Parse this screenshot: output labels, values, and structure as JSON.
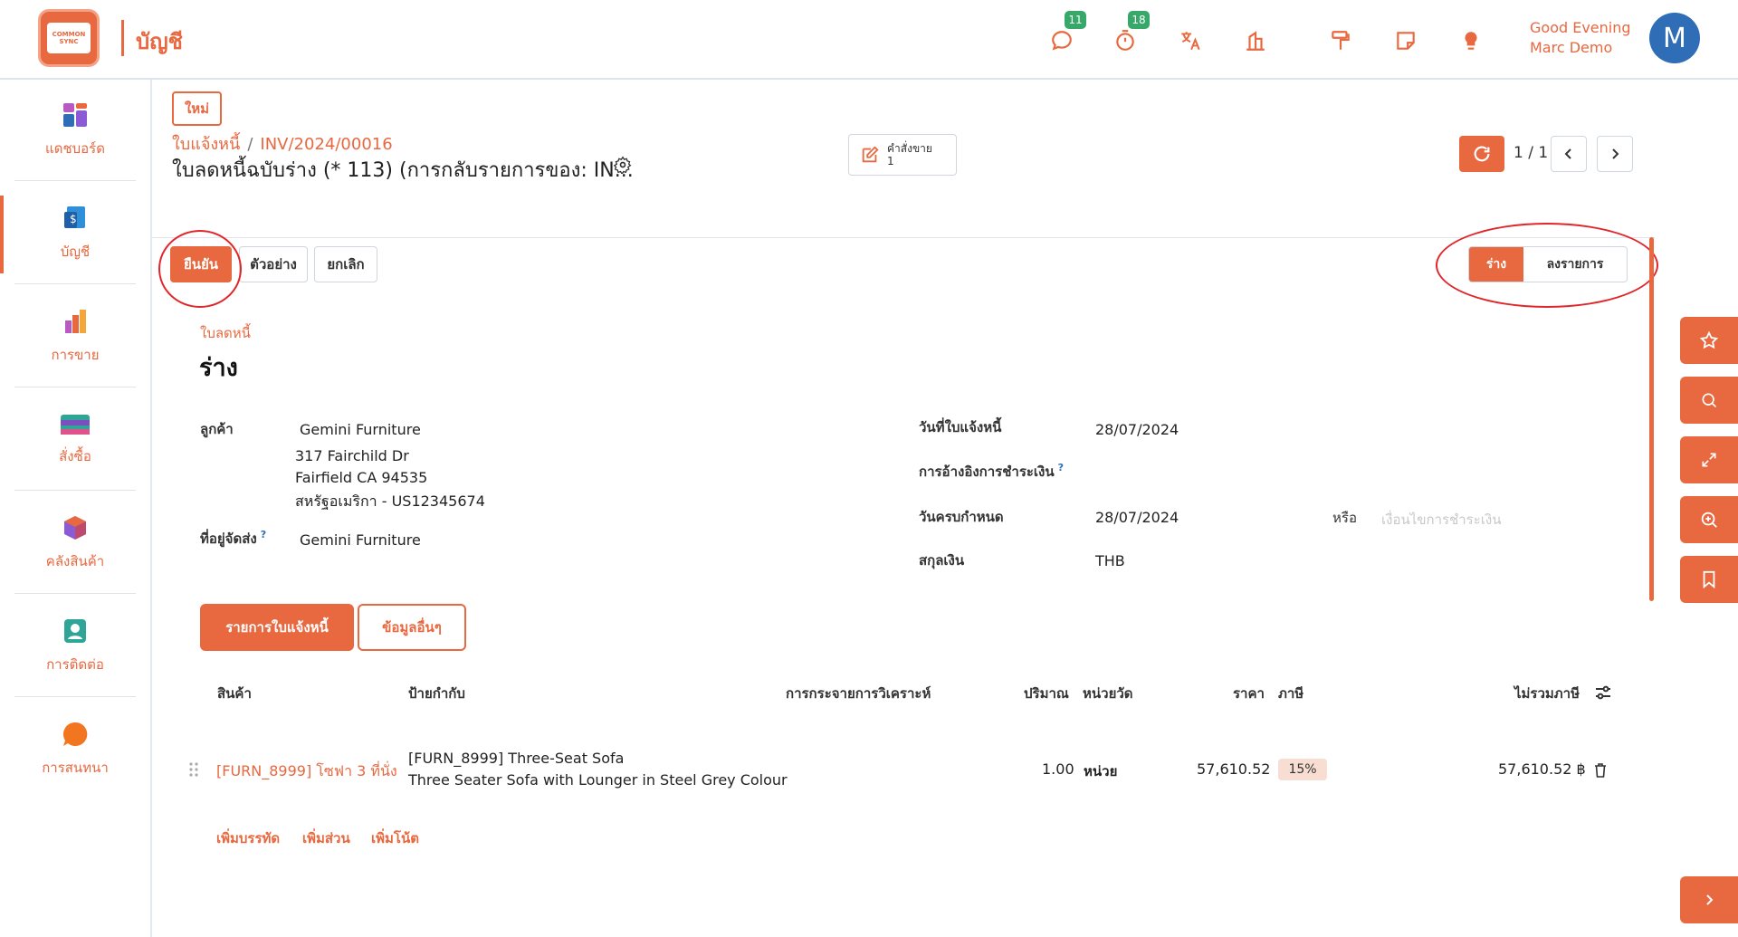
{
  "app": {
    "logo_text": "COMMON SYNC",
    "title": "บัญชี",
    "greeting_line1": "Good Evening",
    "greeting_line2": "Marc Demo",
    "avatar_initial": "M",
    "badges": {
      "messages": "11",
      "activities": "18"
    }
  },
  "sidebar": {
    "items": [
      {
        "label": "แดชบอร์ด",
        "icon": "dashboard-icon"
      },
      {
        "label": "บัญชี",
        "icon": "accounting-icon"
      },
      {
        "label": "การขาย",
        "icon": "sales-icon"
      },
      {
        "label": "สั่งซื้อ",
        "icon": "purchase-icon"
      },
      {
        "label": "คลังสินค้า",
        "icon": "inventory-icon"
      },
      {
        "label": "การติดต่อ",
        "icon": "contacts-icon"
      },
      {
        "label": "การสนทนา",
        "icon": "discuss-icon"
      }
    ]
  },
  "header": {
    "new_label": "ใหม่",
    "breadcrumb_parent": "ใบแจ้งหนี้",
    "breadcrumb_current": "INV/2024/00016",
    "record_title": "ใบลดหนี้ฉบับร่าง (* 113) (การกลับรายการของ: IN...",
    "smart_button_label": "คำสั่งขาย",
    "smart_button_count": "1",
    "pager": "1 / 1"
  },
  "actions": {
    "confirm": "ยืนยัน",
    "preview": "ตัวอย่าง",
    "cancel": "ยกเลิก"
  },
  "status": {
    "draft": "ร่าง",
    "posted": "ลงรายการ"
  },
  "form": {
    "doc_type": "ใบลดหนี้",
    "state": "ร่าง",
    "customer_label": "ลูกค้า",
    "customer_name": "Gemini Furniture",
    "customer_address1": "317 Fairchild Dr",
    "customer_address2": "Fairfield CA 94535",
    "customer_address3": "สหรัฐอเมริกา - US12345674",
    "delivery_label": "ที่อยู่จัดส่ง",
    "delivery_value": "Gemini Furniture",
    "invoice_date_label": "วันที่ใบแจ้งหนี้",
    "invoice_date": "28/07/2024",
    "payment_ref_label": "การอ้างอิงการชำระเงิน",
    "due_date_label": "วันครบกำหนด",
    "due_date": "28/07/2024",
    "or_label": "หรือ",
    "payment_terms_placeholder": "เงื่อนไขการชำระเงิน",
    "currency_label": "สกุลเงิน",
    "currency": "THB"
  },
  "tabs": {
    "lines": "รายการใบแจ้งหนี้",
    "other": "ข้อมูลอื่นๆ"
  },
  "table": {
    "headers": {
      "product": "สินค้า",
      "label": "ป้ายกำกับ",
      "analytic": "การกระจายการวิเคราะห์",
      "quantity": "ปริมาณ",
      "uom": "หน่วยวัด",
      "price": "ราคา",
      "taxes": "ภาษี",
      "subtotal": "ไม่รวมภาษี"
    },
    "rows": [
      {
        "product": "[FURN_8999] โซฟา 3 ที่นั่ง",
        "label_line1": "[FURN_8999] Three-Seat Sofa",
        "label_line2": "Three Seater Sofa with Lounger in Steel Grey Colour",
        "quantity": "1.00",
        "uom": "หน่วย",
        "price": "57,610.52",
        "tax": "15%",
        "subtotal": "57,610.52 ฿"
      }
    ],
    "add_line": "เพิ่มบรรทัด",
    "add_section": "เพิ่มส่วน",
    "add_note": "เพิ่มโน้ต"
  },
  "colors": {
    "accent": "#e8683f",
    "annotation_ring": "#e0262b",
    "badge_green": "#35a86a",
    "avatar_blue": "#2f6db7"
  }
}
